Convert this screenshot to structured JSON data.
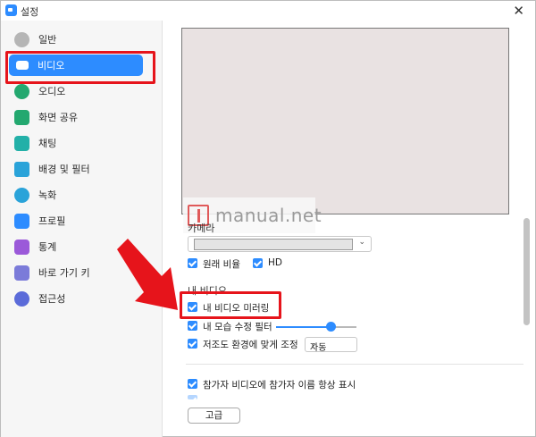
{
  "window": {
    "title": "설정",
    "close": "✕"
  },
  "sidebar": {
    "items": [
      {
        "label": "일반",
        "icon": "gear-icon",
        "color": "#b5b5b5"
      },
      {
        "label": "비디오",
        "icon": "video-camera-icon",
        "color": "#ffffff",
        "active": true
      },
      {
        "label": "오디오",
        "icon": "headphones-icon",
        "color": "#23a86f"
      },
      {
        "label": "화면 공유",
        "icon": "share-screen-icon",
        "color": "#23a86f"
      },
      {
        "label": "채팅",
        "icon": "chat-bubble-icon",
        "color": "#23b0a8"
      },
      {
        "label": "배경 및 필터",
        "icon": "background-filter-icon",
        "color": "#2aa3d9"
      },
      {
        "label": "녹화",
        "icon": "record-icon",
        "color": "#2aa3d9"
      },
      {
        "label": "프로필",
        "icon": "profile-icon",
        "color": "#2d8cff"
      },
      {
        "label": "통계",
        "icon": "statistics-icon",
        "color": "#9b59d9"
      },
      {
        "label": "바로 가기 키",
        "icon": "keyboard-icon",
        "color": "#7b7bd9"
      },
      {
        "label": "접근성",
        "icon": "accessibility-icon",
        "color": "#5b6bd9"
      }
    ]
  },
  "video": {
    "camera_label": "카메라",
    "original_ratio_label": "원래 비율",
    "hd_label": "HD",
    "my_video_label": "내 비디오",
    "mirror_label": "내 비디오 미러링",
    "touch_up_label": "내 모습 수정 필터",
    "touch_up_level": 0.62,
    "low_light_label": "저조도 환경에 맞게 조정",
    "low_light_value": "자동",
    "names_label": "참가자 비디오에 참가자 이름 항상 표시",
    "advanced_button": "고급"
  },
  "watermark": {
    "text": "manual.net"
  },
  "colors": {
    "accent": "#2d8cff",
    "highlight": "#e6141b"
  }
}
